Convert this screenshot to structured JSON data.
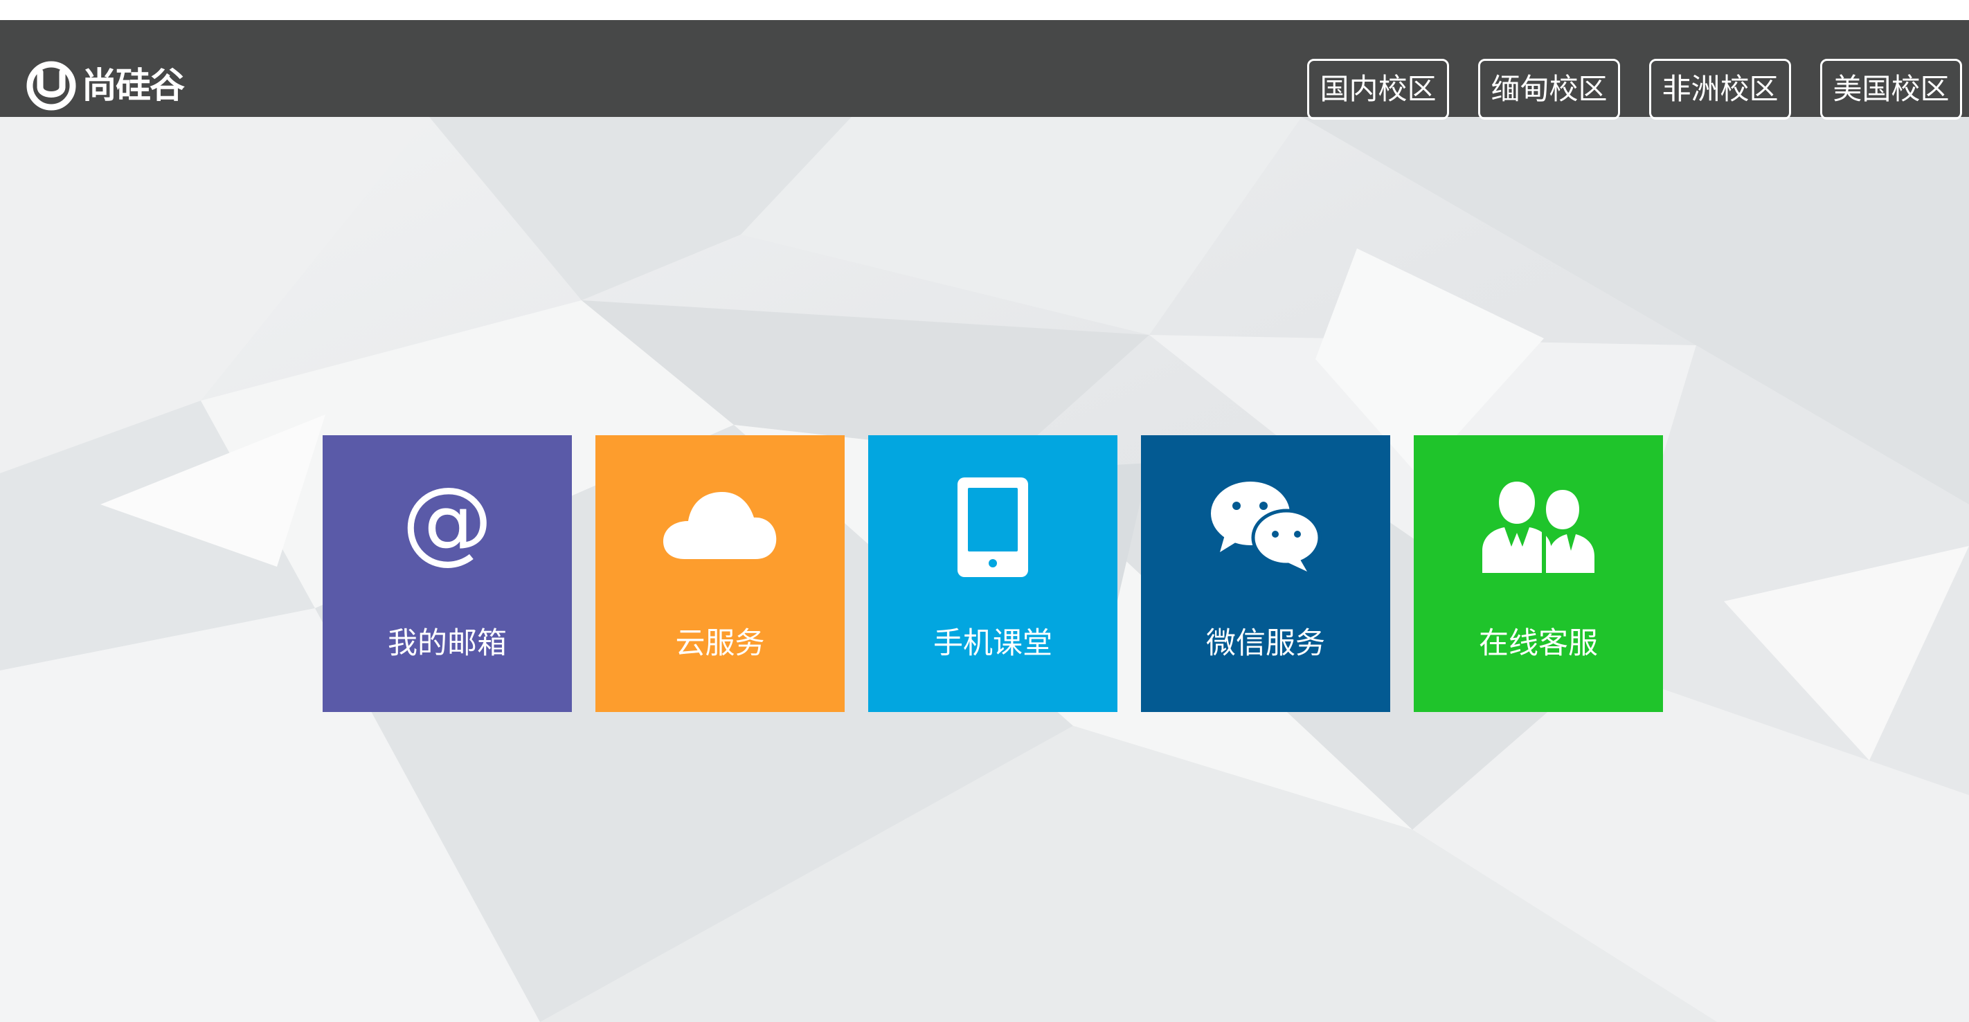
{
  "header": {
    "brand": "尚硅谷",
    "campuses": [
      {
        "label": "国内校区"
      },
      {
        "label": "缅甸校区"
      },
      {
        "label": "非洲校区"
      },
      {
        "label": "美国校区"
      }
    ]
  },
  "tiles": [
    {
      "label": "我的邮箱",
      "icon": "at-icon",
      "color": "#5a5aa8"
    },
    {
      "label": "云服务",
      "icon": "cloud-icon",
      "color": "#fd9d2d"
    },
    {
      "label": "手机课堂",
      "icon": "phone-icon",
      "color": "#02a6e0"
    },
    {
      "label": "微信服务",
      "icon": "wechat-icon",
      "color": "#035a92"
    },
    {
      "label": "在线客服",
      "icon": "users-icon",
      "color": "#1fc42b"
    }
  ]
}
